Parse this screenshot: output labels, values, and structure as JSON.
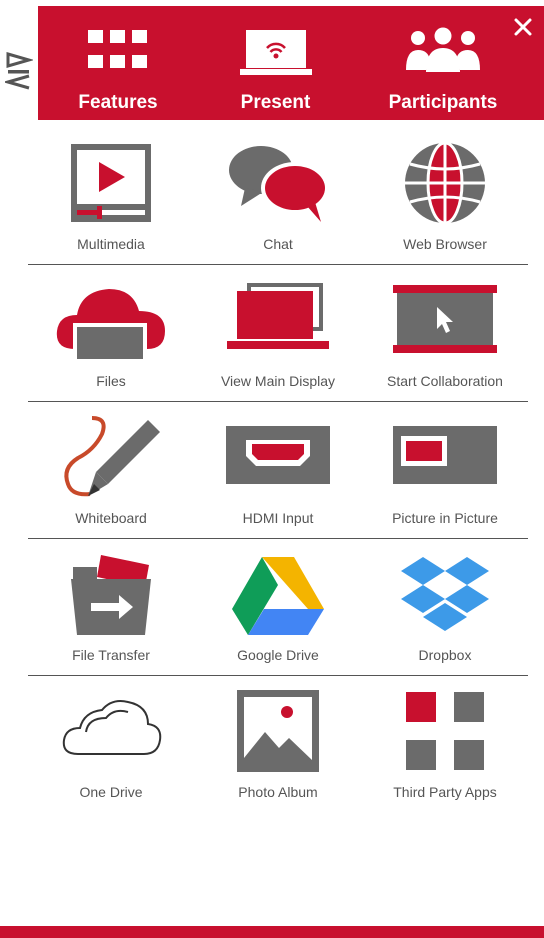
{
  "brand": {
    "accent": "#c8102e",
    "icon_gray": "#6b6b6b",
    "logo": "VIA"
  },
  "header": {
    "tabs": [
      {
        "label": "Features",
        "icon": "grid-icon"
      },
      {
        "label": "Present",
        "icon": "laptop-wifi-icon"
      },
      {
        "label": "Participants",
        "icon": "people-icon"
      }
    ],
    "close_icon": "close-icon"
  },
  "features": [
    {
      "label": "Multimedia",
      "icon": "multimedia-icon"
    },
    {
      "label": "Chat",
      "icon": "chat-icon"
    },
    {
      "label": "Web Browser",
      "icon": "globe-icon"
    },
    {
      "label": "Files",
      "icon": "cloud-files-icon"
    },
    {
      "label": "View Main Display",
      "icon": "laptop-display-icon"
    },
    {
      "label": "Start Collaboration",
      "icon": "collaboration-screen-icon"
    },
    {
      "label": "Whiteboard",
      "icon": "pencil-icon"
    },
    {
      "label": "HDMI Input",
      "icon": "hdmi-icon"
    },
    {
      "label": "Picture in Picture",
      "icon": "pip-icon"
    },
    {
      "label": "File Transfer",
      "icon": "folder-transfer-icon"
    },
    {
      "label": "Google Drive",
      "icon": "google-drive-icon"
    },
    {
      "label": "Dropbox",
      "icon": "dropbox-icon"
    },
    {
      "label": "One Drive",
      "icon": "onedrive-icon"
    },
    {
      "label": "Photo Album",
      "icon": "photo-album-icon"
    },
    {
      "label": "Third Party Apps",
      "icon": "apps-icon"
    }
  ]
}
